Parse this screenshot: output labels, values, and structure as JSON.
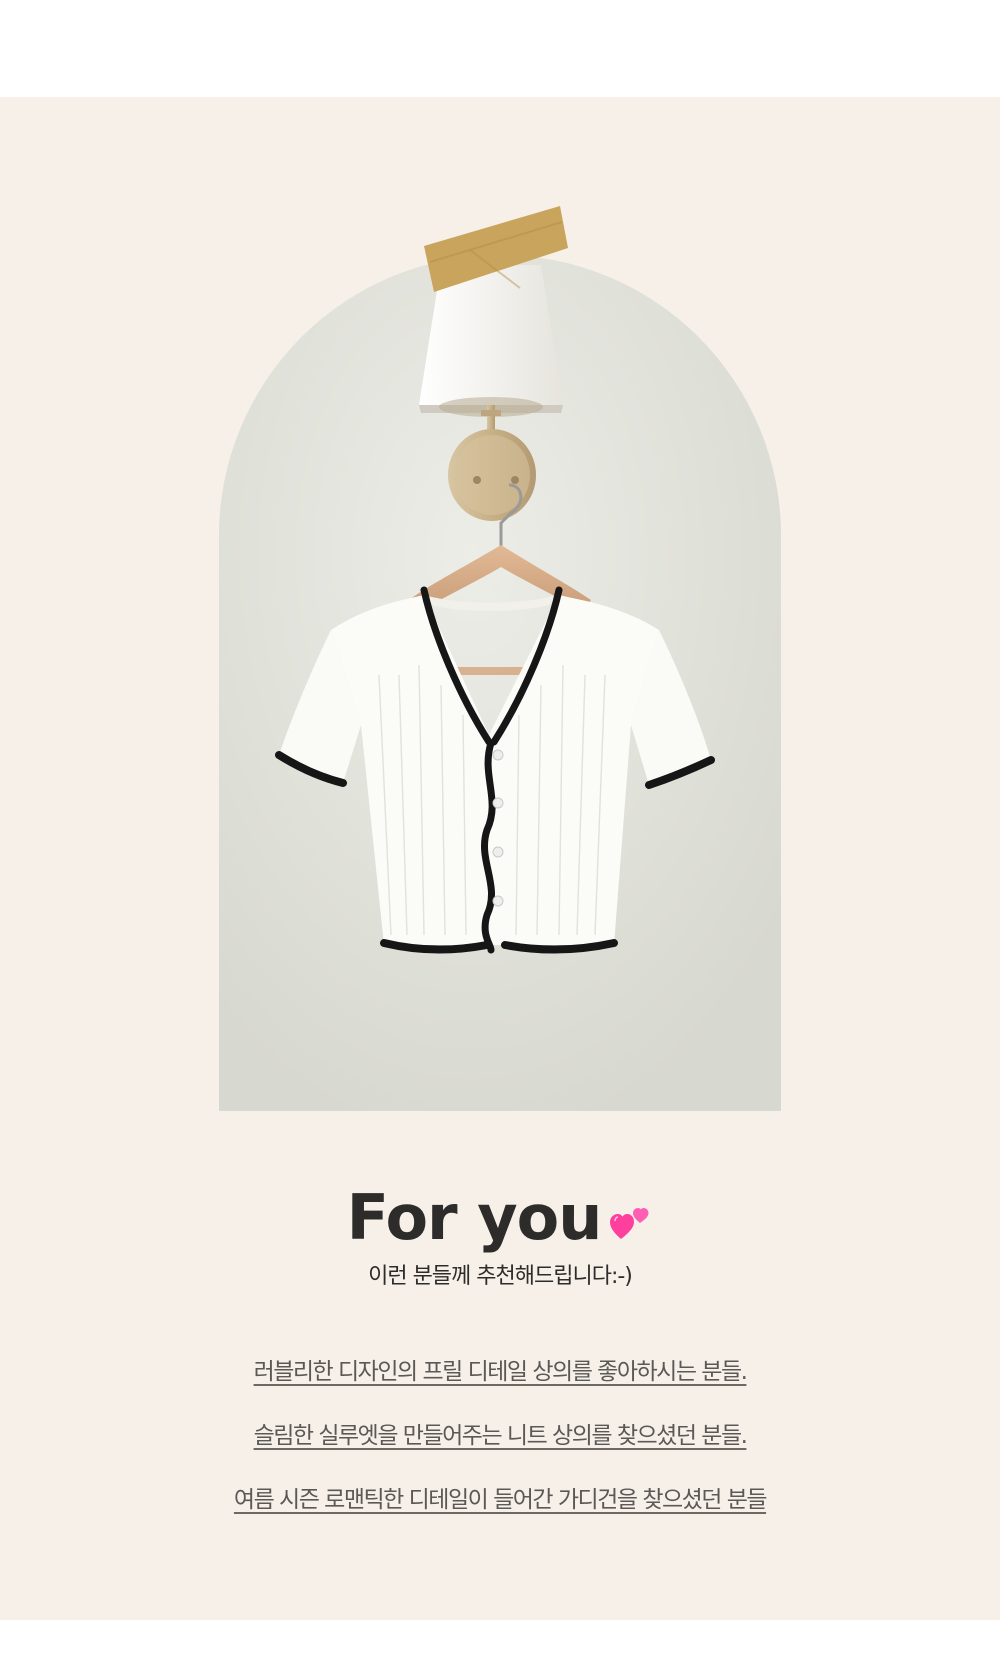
{
  "header": {
    "title": "For you",
    "title_icon": "two-hearts-icon",
    "subtitle": "이런 분들께 추천해드립니다:-)"
  },
  "product_image": {
    "subject": "white ribbed short-sleeve cardigan with black ruffle trim",
    "icons": [
      "tape-icon",
      "wall-lamp-icon",
      "hanger-icon"
    ]
  },
  "recommendations": [
    "러블리한 디자인의 프릴 디테일 상의를 좋아하시는 분들.",
    "슬림한 실루엣을 만들어주는 니트 상의를 찾으셨던 분들.",
    "여름 시즌 로맨틱한 디테일이 들어간 가디건을 찾으셨던 분들"
  ],
  "colors": {
    "background": "#f6f0e9",
    "title": "#2e2c2b",
    "body_text": "#5b5856",
    "heart": "#ff3f9e"
  }
}
